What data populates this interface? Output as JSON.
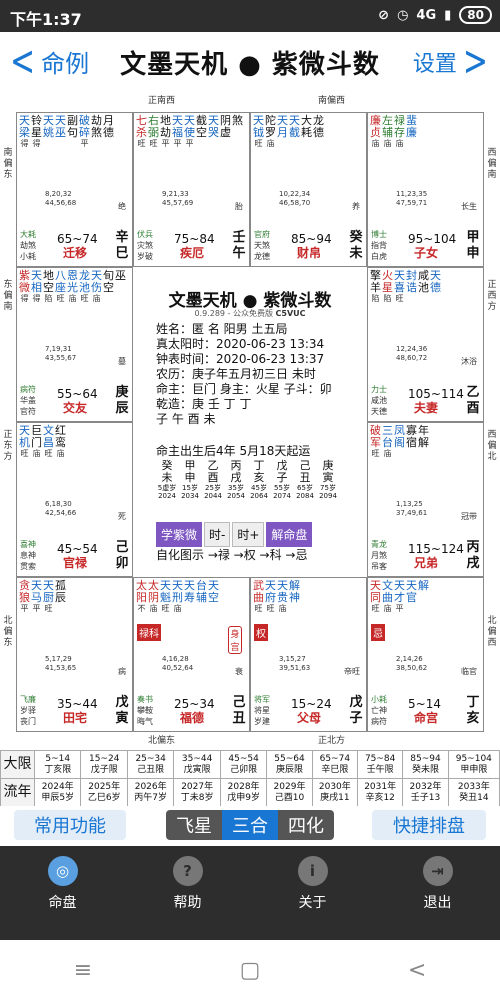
{
  "status": {
    "time": "下午1:37",
    "network": "4G",
    "battery": "80"
  },
  "header": {
    "back_label": "命例",
    "title": "文墨天机 ● 紫微斗数",
    "settings_label": "设置"
  },
  "directions": {
    "top_left": "正南西",
    "top_right": "南偏西",
    "left_top": "南偏东",
    "right_top": "西偏南",
    "left_upper": "东偏南",
    "right_upper": "正西方",
    "left_lower": "正东方",
    "right_lower": "西偏北",
    "left_bottom": "北偏东",
    "right_bottom": "北偏西",
    "bottom_left": "北偏东",
    "bottom_right": "正北方"
  },
  "cells": [
    {
      "key": "si",
      "stars": [
        [
          "天",
          "blue",
          "得"
        ],
        [
          "铃",
          "black",
          "得"
        ],
        [
          "天",
          "blue",
          ""
        ],
        [
          "天",
          "blue",
          ""
        ],
        [
          "副",
          "black",
          ""
        ],
        [
          "破",
          "blue",
          "平"
        ],
        [
          "劫",
          "black",
          ""
        ],
        [
          "月",
          "black",
          ""
        ]
      ],
      "row2": [
        "梁",
        "星",
        "姚",
        "巫",
        "句",
        "碎",
        "煞",
        "德"
      ],
      "nums": [
        "8,20,32",
        "44,56,68"
      ],
      "stage": "绝",
      "bl": [
        "大耗",
        "劫煞",
        "小耗"
      ],
      "range": "65~74",
      "palace": "迁移",
      "gz": [
        "辛",
        "巳"
      ]
    },
    {
      "key": "wu",
      "stars": [
        [
          "七",
          "red",
          "旺"
        ],
        [
          "右",
          "green",
          "旺"
        ],
        [
          "地",
          "black",
          "平"
        ],
        [
          "天",
          "blue",
          "平"
        ],
        [
          "天",
          "blue",
          "平"
        ],
        [
          "截",
          "black",
          ""
        ],
        [
          "天",
          "blue",
          ""
        ],
        [
          "阴",
          "black",
          ""
        ]
      ],
      "row2": [
        "杀",
        "弼",
        "劫",
        "福",
        "使",
        "空",
        "哭",
        "虚",
        "煞"
      ],
      "nums": [
        "9,21,33",
        "45,57,69"
      ],
      "stage": "胎",
      "bl": [
        "伏兵",
        "灾煞",
        "岁破"
      ],
      "range": "75~84",
      "palace": "疾厄",
      "gz": [
        "壬",
        "午"
      ]
    },
    {
      "key": "wei",
      "stars": [
        [
          "天",
          "blue",
          "旺"
        ],
        [
          "陀",
          "black",
          "庙"
        ],
        [
          "天",
          "blue",
          ""
        ],
        [
          "天",
          "blue",
          ""
        ],
        [
          "大",
          "black",
          ""
        ],
        [
          "龙",
          "black",
          ""
        ]
      ],
      "row2": [
        "钺",
        "罗",
        "月",
        "截",
        "耗",
        "德"
      ],
      "nums": [
        "10,22,34",
        "46,58,70"
      ],
      "stage": "养",
      "bl": [
        "官府",
        "天煞",
        "龙德"
      ],
      "range": "85~94",
      "palace": "财帛",
      "gz": [
        "癸",
        "未"
      ]
    },
    {
      "key": "shen",
      "stars": [
        [
          "廉",
          "red",
          "庙"
        ],
        [
          "左",
          "green",
          "庙"
        ],
        [
          "禄",
          "green",
          "庙"
        ],
        [
          "蜚",
          "blue",
          ""
        ]
      ],
      "row2": [
        "贞",
        "辅",
        "存",
        "廉"
      ],
      "nums": [
        "11,23,35",
        "47,59,71"
      ],
      "stage": "长生",
      "bl": [
        "博士",
        "指背",
        "白虎"
      ],
      "range": "95~104",
      "palace": "子女",
      "gz": [
        "甲",
        "申"
      ]
    },
    {
      "key": "chen",
      "stars": [
        [
          "紫",
          "red",
          "得"
        ],
        [
          "天",
          "blue",
          "得"
        ],
        [
          "地",
          "black",
          "陷"
        ],
        [
          "八",
          "blue",
          "旺"
        ],
        [
          "恩",
          "blue",
          "庙"
        ],
        [
          "龙",
          "blue",
          "旺"
        ],
        [
          "天",
          "blue",
          "庙"
        ],
        [
          "旬",
          "black",
          ""
        ]
      ],
      "row2": [
        "微",
        "相",
        "空",
        "座",
        "光",
        "池",
        "伤",
        "空",
        "巫"
      ],
      "nums": [
        "7,19,31",
        "43,55,67"
      ],
      "stage": "墓",
      "bl": [
        "病符",
        "华盖",
        "官符"
      ],
      "range": "55~64",
      "palace": "交友",
      "gz": [
        "庚",
        "辰"
      ]
    },
    {
      "key": "you",
      "stars": [
        [
          "擎",
          "black",
          "陷"
        ],
        [
          "火",
          "red",
          "陷"
        ],
        [
          "天",
          "blue",
          "旺"
        ],
        [
          "封",
          "blue",
          ""
        ],
        [
          "咸",
          "black",
          ""
        ],
        [
          "天",
          "blue",
          ""
        ]
      ],
      "row2": [
        "羊",
        "星",
        "喜",
        "诰",
        "池",
        "德"
      ],
      "nums": [
        "12,24,36",
        "48,60,72"
      ],
      "stage": "沐浴",
      "bl": [
        "力士",
        "咸池",
        "天德"
      ],
      "range": "105~114",
      "palace": "夫妻",
      "gz": [
        "乙",
        "酉"
      ]
    },
    {
      "key": "mao",
      "stars": [
        [
          "天",
          "blue",
          "旺"
        ],
        [
          "巨",
          "black",
          "庙"
        ],
        [
          "文",
          "blue",
          "旺"
        ],
        [
          "红",
          "black",
          "庙"
        ]
      ],
      "row2": [
        "机",
        "门",
        "昌",
        "鸾"
      ],
      "nums": [
        "6,18,30",
        "42,54,66"
      ],
      "stage": "死",
      "bl": [
        "喜神",
        "息神",
        "贯索"
      ],
      "range": "45~54",
      "palace": "官禄",
      "gz": [
        "己",
        "卯"
      ]
    },
    {
      "key": "xu",
      "stars": [
        [
          "破",
          "red",
          "旺"
        ],
        [
          "三",
          "blue",
          "庙"
        ],
        [
          "凤",
          "blue",
          ""
        ],
        [
          "寡",
          "black",
          ""
        ],
        [
          "年",
          "black",
          ""
        ]
      ],
      "row2": [
        "军",
        "台",
        "阁",
        "宿",
        "解"
      ],
      "nums": [
        "1,13,25",
        "37,49,61"
      ],
      "stage": "冠带",
      "bl": [
        "青龙",
        "月煞",
        "吊客"
      ],
      "range": "115~124",
      "palace": "兄弟",
      "gz": [
        "丙",
        "戌"
      ]
    },
    {
      "key": "yin",
      "stars": [
        [
          "贪",
          "red",
          "平"
        ],
        [
          "天",
          "blue",
          "平"
        ],
        [
          "天",
          "blue",
          "旺"
        ],
        [
          "孤",
          "black",
          ""
        ]
      ],
      "row2": [
        "狼",
        "马",
        "厨",
        "辰"
      ],
      "nums": [
        "5,17,29",
        "41,53,65"
      ],
      "stage": "病",
      "bl": [
        "飞廉",
        "岁驿",
        "丧门"
      ],
      "range": "35~44",
      "palace": "田宅",
      "gz": [
        "戊",
        "寅"
      ]
    },
    {
      "key": "chou",
      "stars": [
        [
          "太",
          "red",
          "不"
        ],
        [
          "太",
          "red",
          "庙"
        ],
        [
          "天",
          "blue",
          "旺"
        ],
        [
          "天",
          "blue",
          "庙"
        ],
        [
          "天",
          "blue",
          ""
        ],
        [
          "台",
          "blue",
          ""
        ],
        [
          "天",
          "blue",
          ""
        ]
      ],
      "row2": [
        "阳",
        "阴",
        "魁",
        "刑",
        "寿",
        "辅",
        "空"
      ],
      "nums": [
        "4,16,28",
        "40,52,64"
      ],
      "stage": "衰",
      "bl": [
        "奏书",
        "攀鞍",
        "晦气"
      ],
      "range": "25~34",
      "palace": "福德",
      "gz": [
        "己",
        "丑"
      ]
    },
    {
      "key": "zi",
      "stars": [
        [
          "武",
          "red",
          "旺"
        ],
        [
          "天",
          "blue",
          "旺"
        ],
        [
          "天",
          "blue",
          "庙"
        ],
        [
          "解",
          "blue",
          ""
        ]
      ],
      "row2": [
        "曲",
        "府",
        "贵",
        "神"
      ],
      "nums": [
        "3,15,27",
        "39,51,63"
      ],
      "stage": "帝旺",
      "bl": [
        "将军",
        "将星",
        "岁建"
      ],
      "range": "15~24",
      "palace": "父母",
      "gz": [
        "戊",
        "子"
      ]
    },
    {
      "key": "hai",
      "stars": [
        [
          "天",
          "red",
          "旺"
        ],
        [
          "文",
          "blue",
          "庙"
        ],
        [
          "天",
          "blue",
          "平"
        ],
        [
          "天",
          "blue",
          ""
        ],
        [
          "解",
          "blue",
          ""
        ]
      ],
      "row2": [
        "同",
        "曲",
        "才",
        "官"
      ],
      "nums": [
        "2,14,26",
        "38,50,62"
      ],
      "stage": "临官",
      "bl": [
        "小耗",
        "亡神",
        "病符"
      ],
      "range": "5~14",
      "palace": "命宫",
      "gz": [
        "丁",
        "亥"
      ]
    }
  ],
  "tags": {
    "lu_ke": "禄科",
    "shen_gong": "身宫",
    "quan": "权",
    "ji": "忌"
  },
  "center": {
    "title": "文墨天机 ● 紫微斗数",
    "version": "0.9.289 - 公众免费版",
    "code": "C5VUC",
    "lines": [
      "姓名：匿 名          阳男 土五局",
      "真太阳时：2020-06-23    13:34",
      "钟表时间：2020-06-23    13:37",
      "农历：庚子年五月初三日 未时",
      "命主：巨门 身主：火星 子斗：卯",
      "乾造：庚   壬   丁   丁",
      "            子   午   酉   未"
    ],
    "yun": "命主出生后4年 5月18天起运",
    "dayun": [
      [
        "癸",
        "未",
        "5虚岁",
        "2024"
      ],
      [
        "甲",
        "申",
        "15岁",
        "2034"
      ],
      [
        "乙",
        "酉",
        "25岁",
        "2044"
      ],
      [
        "丙",
        "戌",
        "35岁",
        "2054"
      ],
      [
        "丁",
        "亥",
        "45岁",
        "2064"
      ],
      [
        "戊",
        "子",
        "55岁",
        "2074"
      ],
      [
        "己",
        "丑",
        "65岁",
        "2084"
      ],
      [
        "庚",
        "寅",
        "75岁",
        "2094"
      ]
    ],
    "buttons": [
      "学紫微",
      "时-",
      "时+",
      "解命盘"
    ],
    "zihua": "自化图示 →禄 →权 →科 →忌"
  },
  "limits": {
    "daxian_label": "大限",
    "daxian": [
      "5~14\n丁亥限",
      "15~24\n戊子限",
      "25~34\n己丑限",
      "35~44\n戊寅限",
      "45~54\n己卯限",
      "55~64\n庚辰限",
      "65~74\n辛巳限",
      "75~84\n壬午限",
      "85~94\n癸未限",
      "95~104\n甲申限"
    ],
    "liunian_label": "流年",
    "liunian": [
      "2024年\n甲辰5岁",
      "2025年\n乙巳6岁",
      "2026年\n丙午7岁",
      "2027年\n丁未8岁",
      "2028年\n戊申9岁",
      "2029年\n己酉10",
      "2030年\n庚戌11",
      "2031年\n辛亥12",
      "2032年\n壬子13",
      "2033年\n癸丑14"
    ]
  },
  "funcbar": {
    "common": "常用功能",
    "seg": [
      "飞星",
      "三合",
      "四化"
    ],
    "quick": "快捷排盘"
  },
  "tabbar": [
    "命盘",
    "帮助",
    "关于",
    "退出"
  ]
}
